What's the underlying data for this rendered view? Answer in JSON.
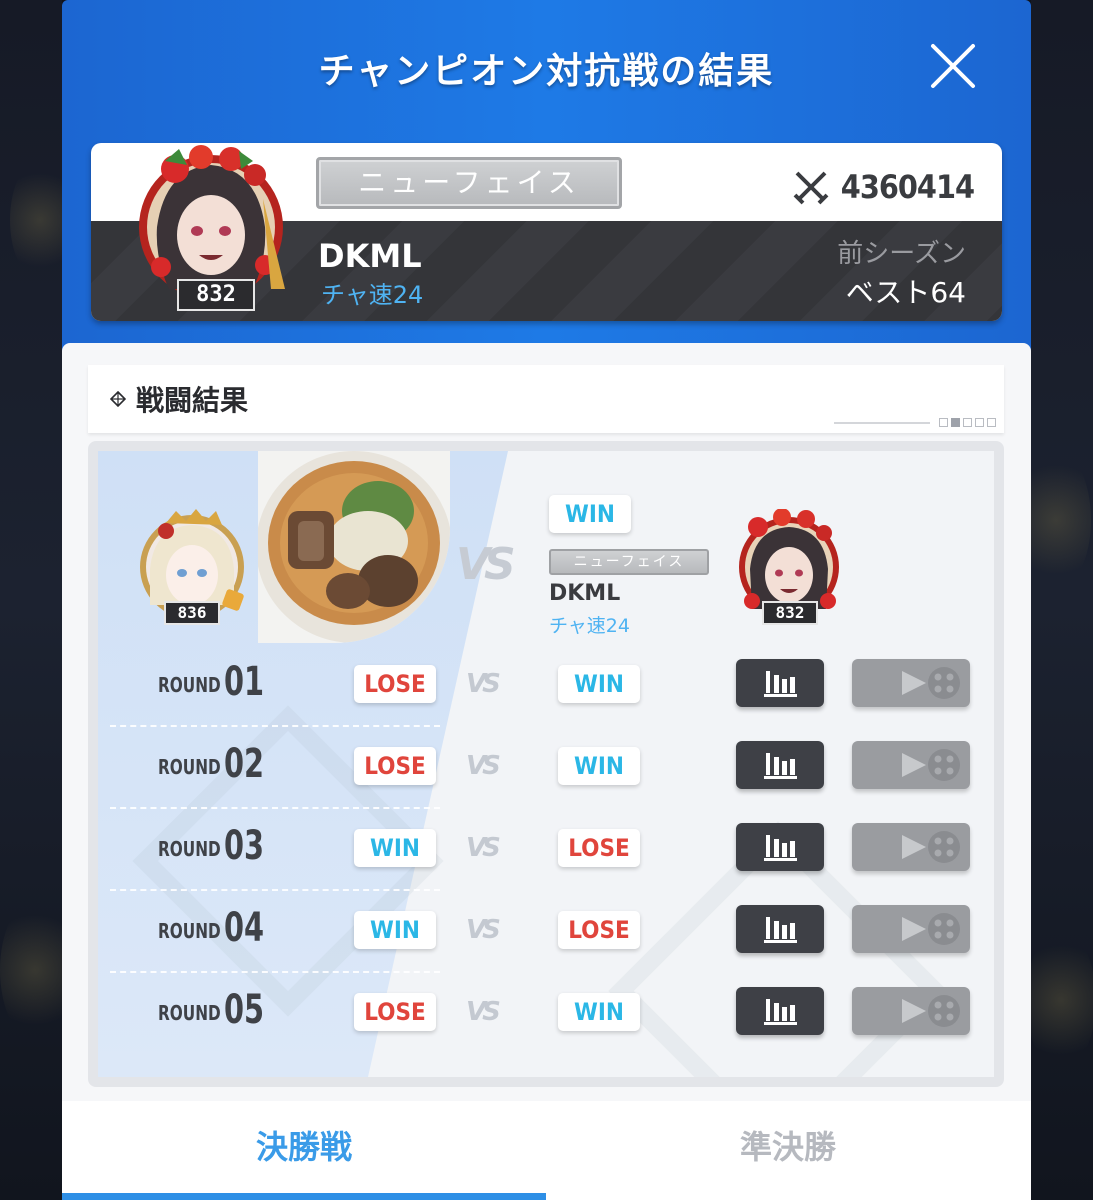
{
  "header": {
    "title": "チャンピオン対抗戦の結果"
  },
  "profile": {
    "level": "832",
    "title_badge": "ニューフェイス",
    "power": "4360414",
    "name": "DKML",
    "guild": "チャ速24",
    "season_label": "前シーズン",
    "season_value": "ベスト64"
  },
  "battle": {
    "section_title": "戦闘結果",
    "opponent_level": "836",
    "vs_label": "VS",
    "final_result": "WIN",
    "me_title_badge": "ニューフェイス",
    "me_name": "DKML",
    "me_guild": "チャ速24",
    "me_level": "832",
    "round_label": "ROUND",
    "rounds": [
      {
        "num": "01",
        "left": "LOSE",
        "right": "WIN"
      },
      {
        "num": "02",
        "left": "LOSE",
        "right": "WIN"
      },
      {
        "num": "03",
        "left": "WIN",
        "right": "LOSE"
      },
      {
        "num": "04",
        "left": "WIN",
        "right": "LOSE"
      },
      {
        "num": "05",
        "left": "LOSE",
        "right": "WIN"
      }
    ]
  },
  "tabs": [
    {
      "label": "決勝戦",
      "active": true
    },
    {
      "label": "準決勝",
      "active": false
    }
  ],
  "colors": {
    "win": "#2bb7e6",
    "lose": "#e0453c",
    "header_blue": "#1e7ae6",
    "guild_blue": "#4fb3f2"
  }
}
